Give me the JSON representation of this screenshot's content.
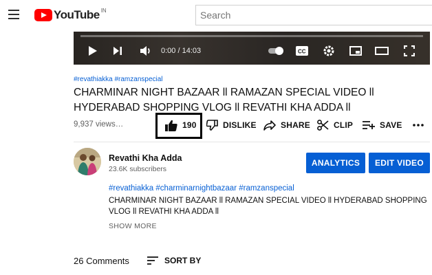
{
  "header": {
    "logo_text": "YouTube",
    "region": "IN",
    "search_placeholder": "Search"
  },
  "player": {
    "time": "0:00 / 14:03"
  },
  "video": {
    "hashtags": "#revathiakka #ramzanspecial",
    "title": "CHARMINAR NIGHT BAZAAR ll RAMAZAN SPECIAL VIDEO ll HYDERABAD SHOPPING VLOG ll REVATHI KHA ADDA ll",
    "views": "9,937 views…",
    "actions": {
      "like_count": "190",
      "dislike": "DISLIKE",
      "share": "SHARE",
      "clip": "CLIP",
      "save": "SAVE"
    }
  },
  "channel": {
    "name": "Revathi Kha Adda",
    "subscribers": "23.6K subscribers",
    "analytics_label": "ANALYTICS",
    "edit_label": "EDIT VIDEO"
  },
  "description": {
    "hashtags": "#revathiakka #charminarnightbazaar #ramzanspecial",
    "text": "CHARMINAR NIGHT BAZAAR ll RAMAZAN SPECIAL VIDEO ll HYDERABAD SHOPPING VLOG ll REVATHI KHA ADDA ll",
    "show_more": "SHOW MORE"
  },
  "comments": {
    "count_label": "26 Comments",
    "sort_label": "SORT BY"
  },
  "colors": {
    "brand_red": "#ff0000",
    "link_blue": "#065fd4",
    "button_blue": "#065fd4"
  },
  "icons": [
    "menu-icon",
    "youtube-logo-icon",
    "play-icon",
    "next-icon",
    "volume-icon",
    "autoplay-toggle-icon",
    "captions-icon",
    "settings-icon",
    "miniplayer-icon",
    "theater-icon",
    "fullscreen-icon",
    "thumbs-up-icon",
    "thumbs-down-icon",
    "share-icon",
    "clip-icon",
    "save-playlist-icon",
    "more-icon",
    "sort-icon"
  ]
}
